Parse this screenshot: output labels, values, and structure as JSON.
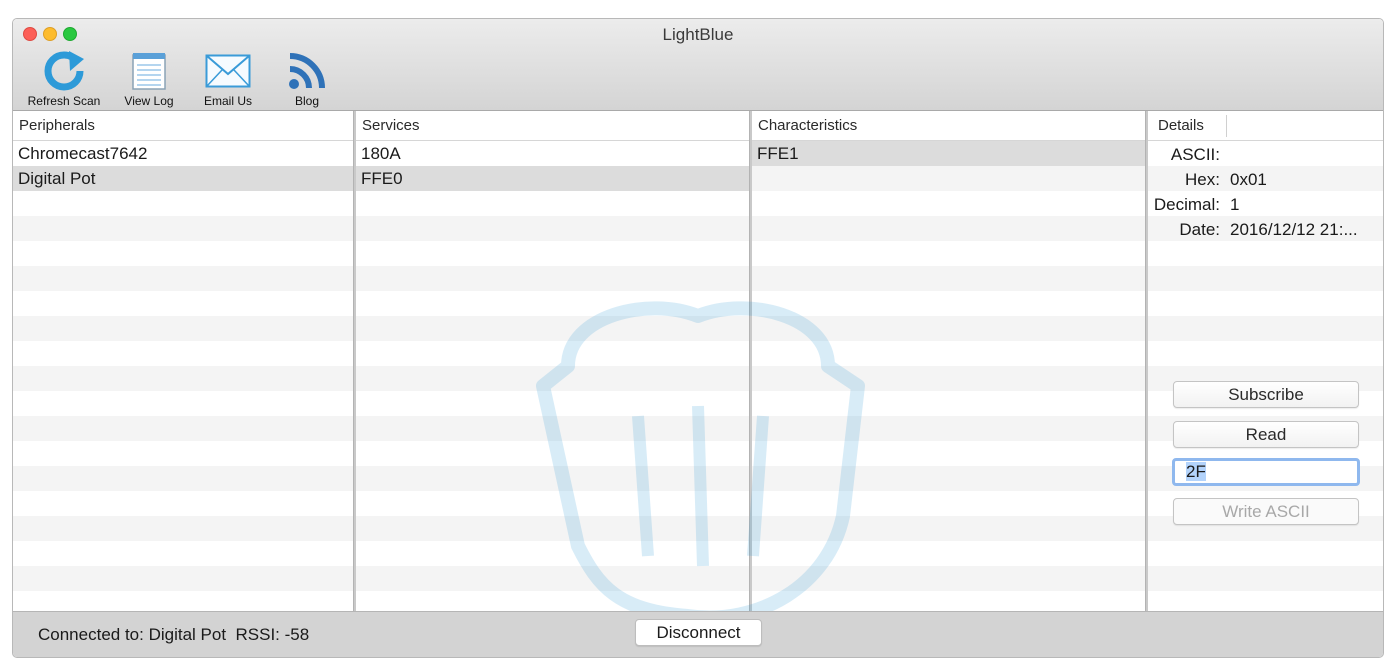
{
  "window": {
    "title": "LightBlue"
  },
  "toolbar": {
    "refresh_label": "Refresh Scan",
    "viewlog_label": "View Log",
    "email_label": "Email Us",
    "blog_label": "Blog"
  },
  "peripherals": {
    "header": "Peripherals",
    "items": [
      "Chromecast7642",
      "Digital Pot"
    ],
    "selected": "Digital Pot"
  },
  "services": {
    "header": "Services",
    "items": [
      "180A",
      "FFE0"
    ],
    "selected": "FFE0"
  },
  "characteristics": {
    "header": "Characteristics",
    "items": [
      "FFE1"
    ],
    "selected": "FFE1"
  },
  "details": {
    "header": "Details",
    "ascii_key": "ASCII:",
    "ascii_value": "",
    "hex_key": "Hex:",
    "hex_value": "0x01",
    "decimal_key": "Decimal:",
    "decimal_value": "1",
    "date_key": "Date:",
    "date_value": "2016/12/12 21:...",
    "subscribe_label": "Subscribe",
    "read_label": "Read",
    "input_value": "2F",
    "write_label": "Write ASCII"
  },
  "status": {
    "connected_text": "Connected to: Digital Pot  RSSI: -58",
    "disconnect_label": "Disconnect"
  },
  "colors": {
    "accent": "#2d9ad8",
    "selection": "#dcdcdc",
    "focus_ring": "#8fb8ee"
  }
}
